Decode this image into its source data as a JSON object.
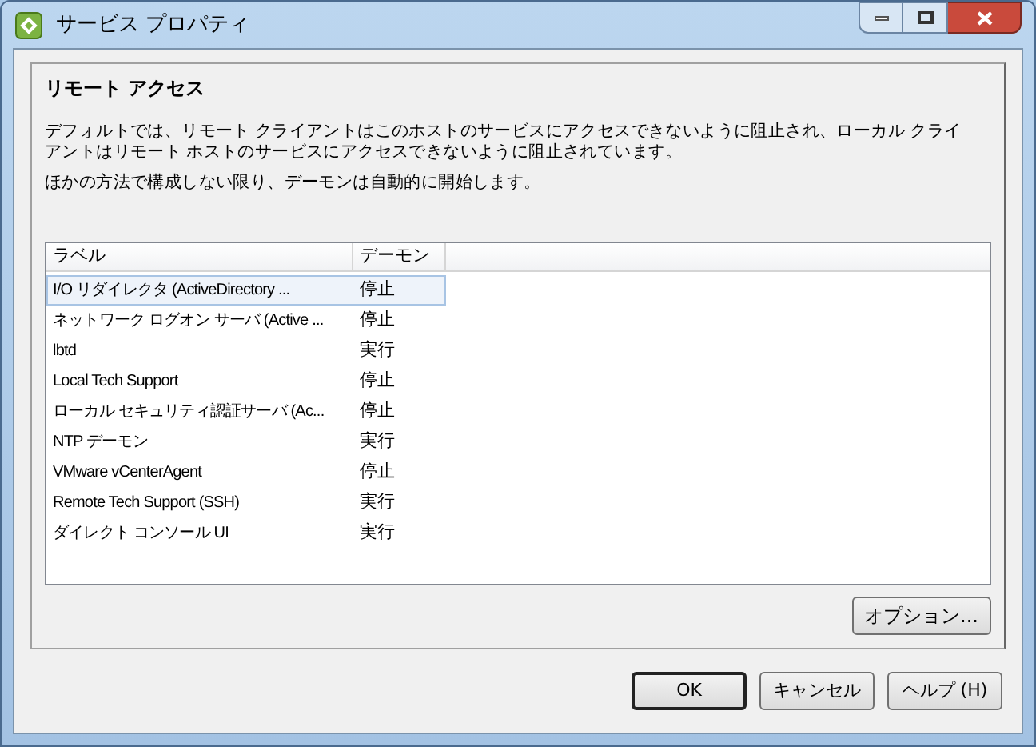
{
  "window": {
    "title": "サービス プロパティ"
  },
  "section": {
    "title": "リモート アクセス",
    "paragraphs": [
      "デフォルトでは、リモート クライアントはこのホストのサービスにアクセスできないように阻止され、ローカル クライアントはリモート ホストのサービスにアクセスできないように阻止されています。",
      "ほかの方法で構成しない限り、デーモンは自動的に開始します。"
    ]
  },
  "table": {
    "columns": [
      "ラベル",
      "デーモン"
    ],
    "rows": [
      {
        "label": "I/O リダイレクタ (ActiveDirectory ...",
        "daemon": "停止",
        "selected": true
      },
      {
        "label": "ネットワーク ログオン サーバ (Active ...",
        "daemon": "停止",
        "selected": false
      },
      {
        "label": "lbtd",
        "daemon": "実行",
        "selected": false
      },
      {
        "label": "Local Tech Support",
        "daemon": "停止",
        "selected": false
      },
      {
        "label": "ローカル セキュリティ認証サーバ (Ac...",
        "daemon": "停止",
        "selected": false
      },
      {
        "label": "NTP デーモン",
        "daemon": "実行",
        "selected": false
      },
      {
        "label": "VMware vCenterAgent",
        "daemon": "停止",
        "selected": false
      },
      {
        "label": "Remote Tech Support (SSH)",
        "daemon": "実行",
        "selected": false
      },
      {
        "label": "ダイレクト コンソール UI",
        "daemon": "実行",
        "selected": false
      }
    ]
  },
  "options_button": "オプション...",
  "buttons": [
    {
      "label": "OK",
      "default": true
    },
    {
      "label": "キャンセル",
      "default": false
    },
    {
      "label": "ヘルプ (H)",
      "default": false
    }
  ]
}
